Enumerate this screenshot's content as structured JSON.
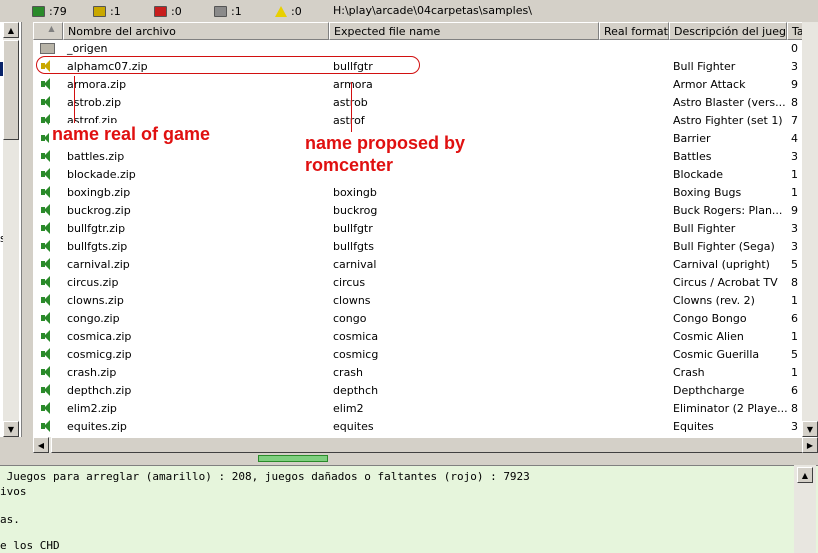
{
  "status": {
    "items": [
      {
        "icon": "green-computer-icon",
        "color": "#2a8a2a",
        "text": ":79"
      },
      {
        "icon": "yellow-computer-icon",
        "color": "#c9a800",
        "text": ":1"
      },
      {
        "icon": "red-computer-icon",
        "color": "#c81e1e",
        "text": ":0"
      },
      {
        "icon": "gray-computer-icon",
        "color": "#8a8a8a",
        "text": ":1"
      },
      {
        "icon": "warning-icon",
        "color": "#e8d000",
        "text": ":0"
      }
    ],
    "path": "H:\\play\\arcade\\04carpetas\\samples\\"
  },
  "table": {
    "headers": [
      "Nombre del archivo",
      "Expected file name",
      "Real format",
      "Descripción del juego",
      "Tama"
    ],
    "rows": [
      {
        "icon": "folder",
        "file": "_origen",
        "expected": "",
        "real": "",
        "desc": "",
        "size": "0"
      },
      {
        "icon": "yellow",
        "file": "alphamc07.zip",
        "expected": "bullfgtr",
        "real": "",
        "desc": "Bull Fighter",
        "size": "3"
      },
      {
        "icon": "green",
        "file": "armora.zip",
        "expected": "armora",
        "real": "",
        "desc": "Armor Attack",
        "size": "9"
      },
      {
        "icon": "green",
        "file": "astrob.zip",
        "expected": "astrob",
        "real": "",
        "desc": "Astro Blaster (vers...",
        "size": "8"
      },
      {
        "icon": "green",
        "file": "astrof.zip",
        "expected": "astrof",
        "real": "",
        "desc": "Astro Fighter (set 1)",
        "size": "7"
      },
      {
        "icon": "green",
        "file": "",
        "expected": "",
        "real": "",
        "desc": "Barrier",
        "size": "4"
      },
      {
        "icon": "green",
        "file": "battles.zip",
        "expected": "",
        "real": "",
        "desc": "Battles",
        "size": "3"
      },
      {
        "icon": "green",
        "file": "blockade.zip",
        "expected": "",
        "real": "",
        "desc": "Blockade",
        "size": "1"
      },
      {
        "icon": "green",
        "file": "boxingb.zip",
        "expected": "boxingb",
        "real": "",
        "desc": "Boxing Bugs",
        "size": "1"
      },
      {
        "icon": "green",
        "file": "buckrog.zip",
        "expected": "buckrog",
        "real": "",
        "desc": "Buck Rogers: Plan...",
        "size": "9"
      },
      {
        "icon": "green",
        "file": "bullfgtr.zip",
        "expected": "bullfgtr",
        "real": "",
        "desc": "Bull Fighter",
        "size": "3"
      },
      {
        "icon": "green",
        "file": "bullfgts.zip",
        "expected": "bullfgts",
        "real": "",
        "desc": "Bull Fighter (Sega)",
        "size": "3"
      },
      {
        "icon": "green",
        "file": "carnival.zip",
        "expected": "carnival",
        "real": "",
        "desc": "Carnival (upright)",
        "size": "5"
      },
      {
        "icon": "green",
        "file": "circus.zip",
        "expected": "circus",
        "real": "",
        "desc": "Circus / Acrobat TV",
        "size": "8"
      },
      {
        "icon": "green",
        "file": "clowns.zip",
        "expected": "clowns",
        "real": "",
        "desc": "Clowns (rev. 2)",
        "size": "1"
      },
      {
        "icon": "green",
        "file": "congo.zip",
        "expected": "congo",
        "real": "",
        "desc": "Congo Bongo",
        "size": "6"
      },
      {
        "icon": "green",
        "file": "cosmica.zip",
        "expected": "cosmica",
        "real": "",
        "desc": "Cosmic Alien",
        "size": "1"
      },
      {
        "icon": "green",
        "file": "cosmicg.zip",
        "expected": "cosmicg",
        "real": "",
        "desc": "Cosmic Guerilla",
        "size": "5"
      },
      {
        "icon": "green",
        "file": "crash.zip",
        "expected": "crash",
        "real": "",
        "desc": "Crash",
        "size": "1"
      },
      {
        "icon": "green",
        "file": "depthch.zip",
        "expected": "depthch",
        "real": "",
        "desc": "Depthcharge",
        "size": "6"
      },
      {
        "icon": "green",
        "file": "elim2.zip",
        "expected": "elim2",
        "real": "",
        "desc": "Eliminator (2 Playe...",
        "size": "8"
      },
      {
        "icon": "green",
        "file": "equites.zip",
        "expected": "equites",
        "real": "",
        "desc": "Equites",
        "size": "3"
      }
    ]
  },
  "annotations": {
    "left": "name real of game",
    "right_line1": "name proposed by",
    "right_line2": "romcenter"
  },
  "log": {
    "lines": [
      " Juegos para arreglar (amarillo) : 208, juegos dañados o faltantes (rojo) : 7923",
      "ivos",
      "",
      "as.",
      "",
      "e los CHD"
    ]
  },
  "left_panel_text": "s."
}
